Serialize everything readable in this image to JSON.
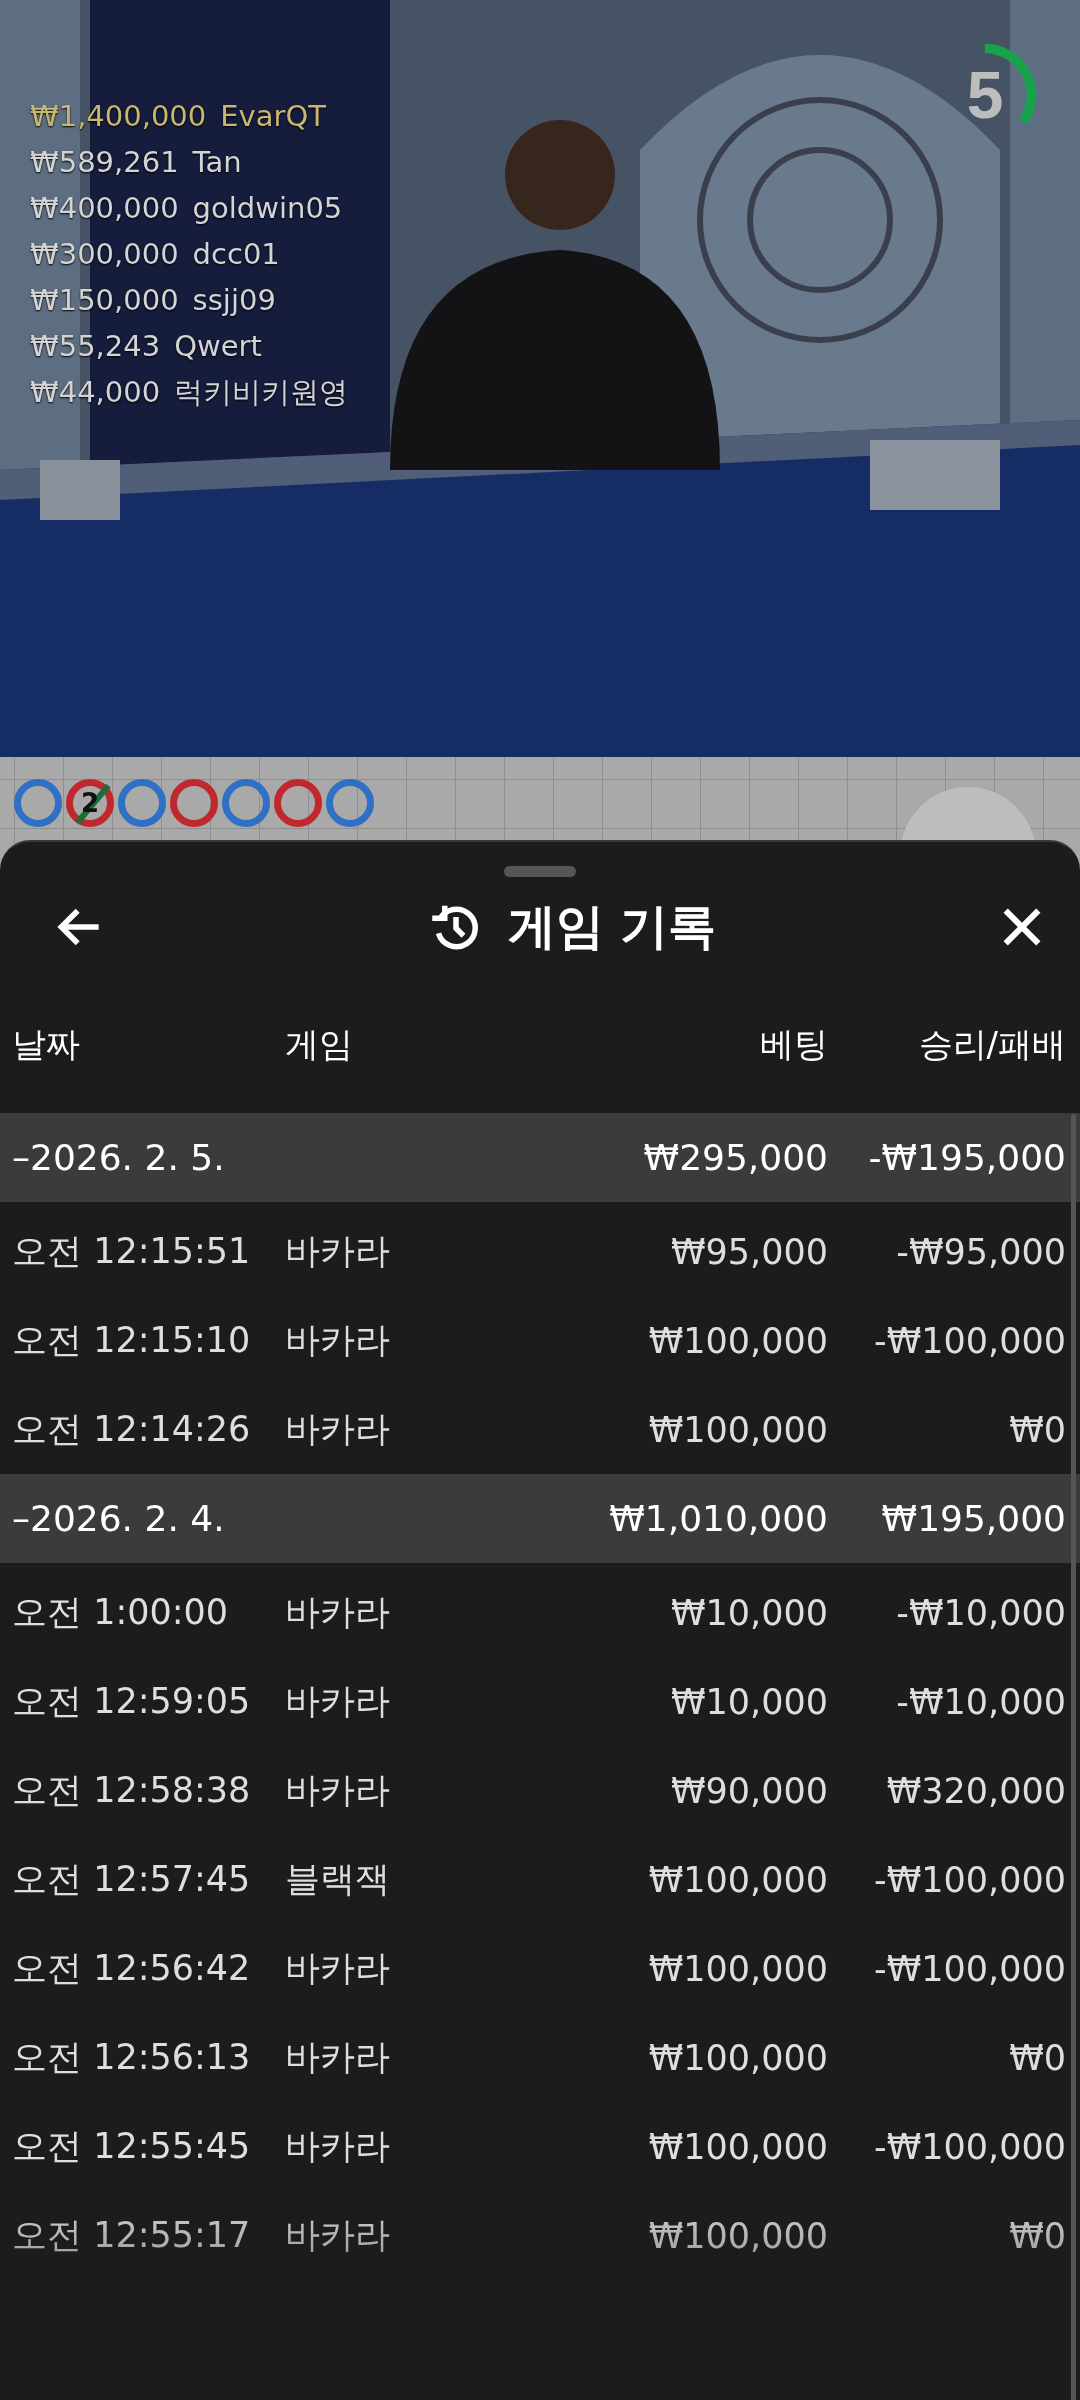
{
  "video": {
    "countdown": {
      "value": "5"
    },
    "leaderboard": [
      {
        "amount": "₩1,400,000",
        "name": "EvarQT",
        "color": "#c9b671"
      },
      {
        "amount": "₩589,261",
        "name": "Tan",
        "color": "#d4d4d4"
      },
      {
        "amount": "₩400,000",
        "name": "goldwin05",
        "color": "#d4d4d4"
      },
      {
        "amount": "₩300,000",
        "name": "dcc01",
        "color": "#d4d4d4"
      },
      {
        "amount": "₩150,000",
        "name": "ssjj09",
        "color": "#d4d4d4"
      },
      {
        "amount": "₩55,243",
        "name": "Qwert",
        "color": "#d4d4d4"
      },
      {
        "amount": "₩44,000",
        "name": "럭키비키원영",
        "color": "#d4d4d4"
      }
    ]
  },
  "roadmap": {
    "beads": [
      {
        "color": "#2f6fc4",
        "tie": false
      },
      {
        "color": "#c0282e",
        "label": "2",
        "tie": true
      },
      {
        "color": "#2f6fc4",
        "tie": false
      },
      {
        "color": "#c0282e",
        "tie": false
      },
      {
        "color": "#2f6fc4",
        "tie": false
      },
      {
        "color": "#c0282e",
        "tie": false
      },
      {
        "color": "#2f6fc4",
        "tie": false
      }
    ]
  },
  "sheet": {
    "title": "게임 기록",
    "columns": [
      "날짜",
      "게임",
      "베팅",
      "승리/패배"
    ],
    "groups": [
      {
        "date": "–2026. 2. 5.",
        "bet": "₩295,000",
        "result": "-₩195,000",
        "rows": [
          {
            "time": "오전 12:15:51",
            "game": "바카라",
            "bet": "₩95,000",
            "result": "-₩95,000"
          },
          {
            "time": "오전 12:15:10",
            "game": "바카라",
            "bet": "₩100,000",
            "result": "-₩100,000"
          },
          {
            "time": "오전 12:14:26",
            "game": "바카라",
            "bet": "₩100,000",
            "result": "₩0"
          }
        ]
      },
      {
        "date": "–2026. 2. 4.",
        "bet": "₩1,010,000",
        "result": "₩195,000",
        "rows": [
          {
            "time": "오전 1:00:00",
            "game": "바카라",
            "bet": "₩10,000",
            "result": "-₩10,000"
          },
          {
            "time": "오전 12:59:05",
            "game": "바카라",
            "bet": "₩10,000",
            "result": "-₩10,000"
          },
          {
            "time": "오전 12:58:38",
            "game": "바카라",
            "bet": "₩90,000",
            "result": "₩320,000"
          },
          {
            "time": "오전 12:57:45",
            "game": "블랙잭",
            "bet": "₩100,000",
            "result": "-₩100,000"
          },
          {
            "time": "오전 12:56:42",
            "game": "바카라",
            "bet": "₩100,000",
            "result": "-₩100,000"
          },
          {
            "time": "오전 12:56:13",
            "game": "바카라",
            "bet": "₩100,000",
            "result": "₩0"
          },
          {
            "time": "오전 12:55:45",
            "game": "바카라",
            "bet": "₩100,000",
            "result": "-₩100,000"
          },
          {
            "time": "오전 12:55:17",
            "game": "바카라",
            "bet": "₩100,000",
            "result": "₩0"
          }
        ]
      }
    ]
  }
}
